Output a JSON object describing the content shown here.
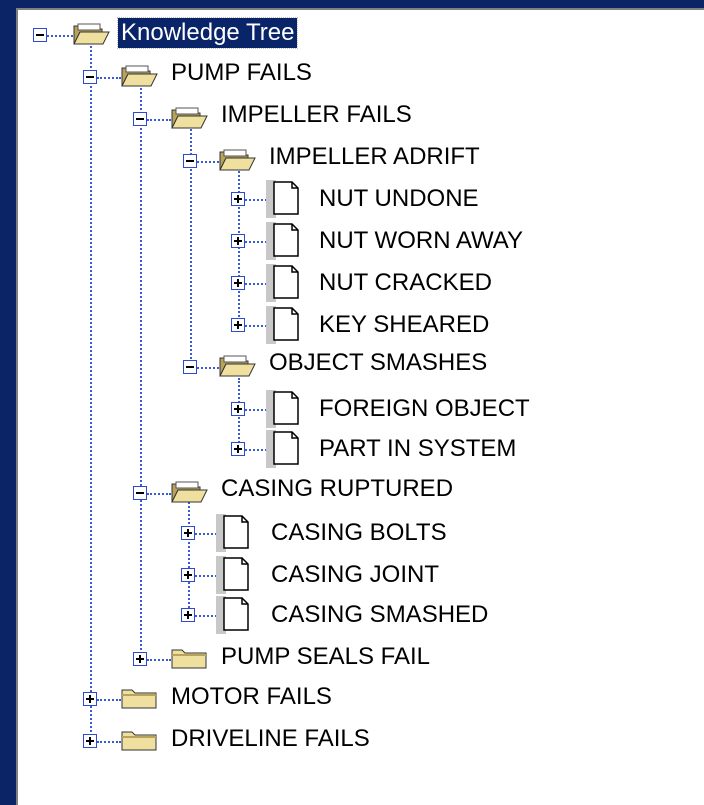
{
  "tree": {
    "root": {
      "label": "Knowledge Tree",
      "icon": "open-folder-icon",
      "expanded": true,
      "selected": true
    },
    "items": {
      "pump_fails": "PUMP FAILS",
      "impeller_fails": "IMPELLER FAILS",
      "impeller_adrift": "IMPELLER ADRIFT",
      "nut_undone": "NUT UNDONE",
      "nut_worn_away": "NUT WORN AWAY",
      "nut_cracked": "NUT CRACKED",
      "key_sheared": "KEY SHEARED",
      "object_smashes": "OBJECT SMASHES",
      "foreign_object": "FOREIGN OBJECT",
      "part_in_system": "PART IN SYSTEM",
      "casing_ruptured": "CASING RUPTURED",
      "casing_bolts": "CASING BOLTS",
      "casing_joint": "CASING JOINT",
      "casing_smashed": "CASING SMASHED",
      "pump_seals_fail": "PUMP SEALS FAIL",
      "motor_fails": "MOTOR FAILS",
      "driveline_fails": "DRIVELINE FAILS"
    }
  },
  "colors": {
    "background": "#0a2466",
    "selection": "#0a246a",
    "folder": "#e8d27a",
    "connector": "#3a5bd6"
  }
}
